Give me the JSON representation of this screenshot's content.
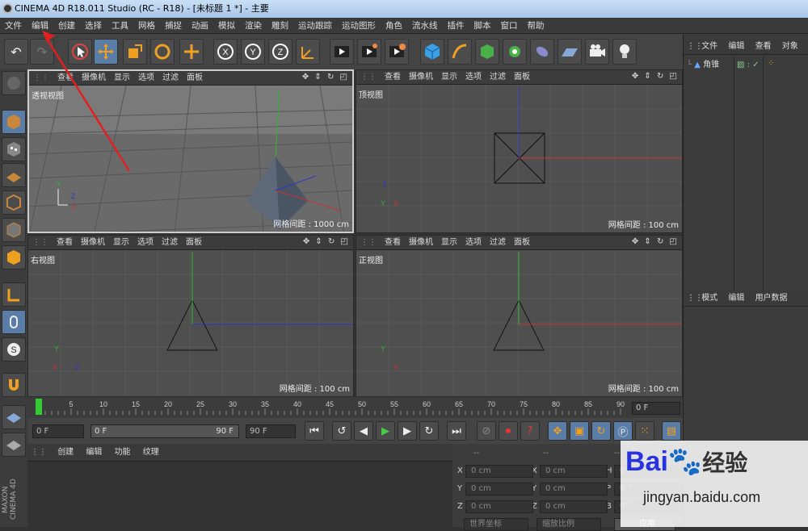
{
  "title": "CINEMA 4D R18.011 Studio (RC - R18) - [未标题 1 *] - 主要",
  "menu": [
    "文件",
    "编辑",
    "创建",
    "选择",
    "工具",
    "网格",
    "捕捉",
    "动画",
    "模拟",
    "渲染",
    "雕刻",
    "运动跟踪",
    "运动图形",
    "角色",
    "流水线",
    "插件",
    "脚本",
    "窗口",
    "帮助"
  ],
  "viewport_menu": [
    "查看",
    "摄像机",
    "显示",
    "选项",
    "过滤",
    "面板"
  ],
  "viewports": [
    {
      "name": "透视视图",
      "grid": "网格间距 : 1000 cm"
    },
    {
      "name": "顶视图",
      "grid": "网格间距 : 100 cm"
    },
    {
      "name": "右视图",
      "grid": "网格间距 : 100 cm"
    },
    {
      "name": "正视图",
      "grid": "网格间距 : 100 cm"
    }
  ],
  "object_panel": {
    "menu": [
      "文件",
      "编辑",
      "查看",
      "对象"
    ],
    "object_name": "角锥"
  },
  "attr_panel": {
    "menu": [
      "模式",
      "编辑",
      "用户数据"
    ]
  },
  "timeline": {
    "ticks": [
      "0",
      "5",
      "10",
      "15",
      "20",
      "25",
      "30",
      "35",
      "40",
      "45",
      "50",
      "55",
      "60",
      "65",
      "70",
      "75",
      "80",
      "85",
      "90"
    ],
    "end_frame": "0 F"
  },
  "transport": {
    "current": "0 F",
    "range_start": "0 F",
    "range_end": "90 F",
    "max": "90 F"
  },
  "material_panel": {
    "menu": [
      "创建",
      "编辑",
      "功能",
      "纹理"
    ]
  },
  "coords": {
    "headers": [
      "--",
      "--",
      "--"
    ],
    "rows": [
      {
        "l1": "X",
        "v1": "0 cm",
        "l2": "X",
        "v2": "0 cm",
        "l3": "H",
        "v3": "0 °"
      },
      {
        "l1": "Y",
        "v1": "0 cm",
        "l2": "Y",
        "v2": "0 cm",
        "l3": "P",
        "v3": "0 °"
      },
      {
        "l1": "Z",
        "v1": "0 cm",
        "l2": "Z",
        "v2": "0 cm",
        "l3": "B",
        "v3": "0 °"
      }
    ],
    "mode1": "世界坐标",
    "mode2": "缩放比例",
    "apply": "应用"
  },
  "watermark": {
    "brand": "Bai",
    "brand2": "经验",
    "url": "jingyan.baidu.com"
  },
  "side_brand": "MAXON CINEMA 4D",
  "colors": {
    "accent": "#5a7da8",
    "x_axis": "#c83232",
    "y_axis": "#32b432",
    "z_axis": "#3232c8",
    "arrow": "#e02020"
  }
}
